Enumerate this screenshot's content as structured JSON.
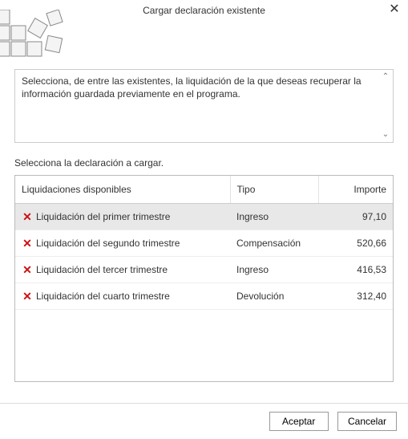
{
  "title": "Cargar declaración existente",
  "instructions": "Selecciona, de entre las existentes, la liquidación de la que deseas recuperar la información guardada previamente en el programa.",
  "prompt": "Selecciona la declaración a cargar.",
  "columns": {
    "name": "Liquidaciones disponibles",
    "type": "Tipo",
    "amount": "Importe"
  },
  "rows": [
    {
      "name": "Liquidación del primer trimestre",
      "type": "Ingreso",
      "amount": "97,10",
      "selected": true
    },
    {
      "name": "Liquidación del segundo trimestre",
      "type": "Compensación",
      "amount": "520,66",
      "selected": false
    },
    {
      "name": "Liquidación del tercer trimestre",
      "type": "Ingreso",
      "amount": "416,53",
      "selected": false
    },
    {
      "name": "Liquidación del cuarto trimestre",
      "type": "Devolución",
      "amount": "312,40",
      "selected": false
    }
  ],
  "buttons": {
    "accept": "Aceptar",
    "cancel": "Cancelar"
  },
  "icons": {
    "close": "✕",
    "delete": "✕",
    "scroll_up": "⌃",
    "scroll_down": "⌄"
  }
}
